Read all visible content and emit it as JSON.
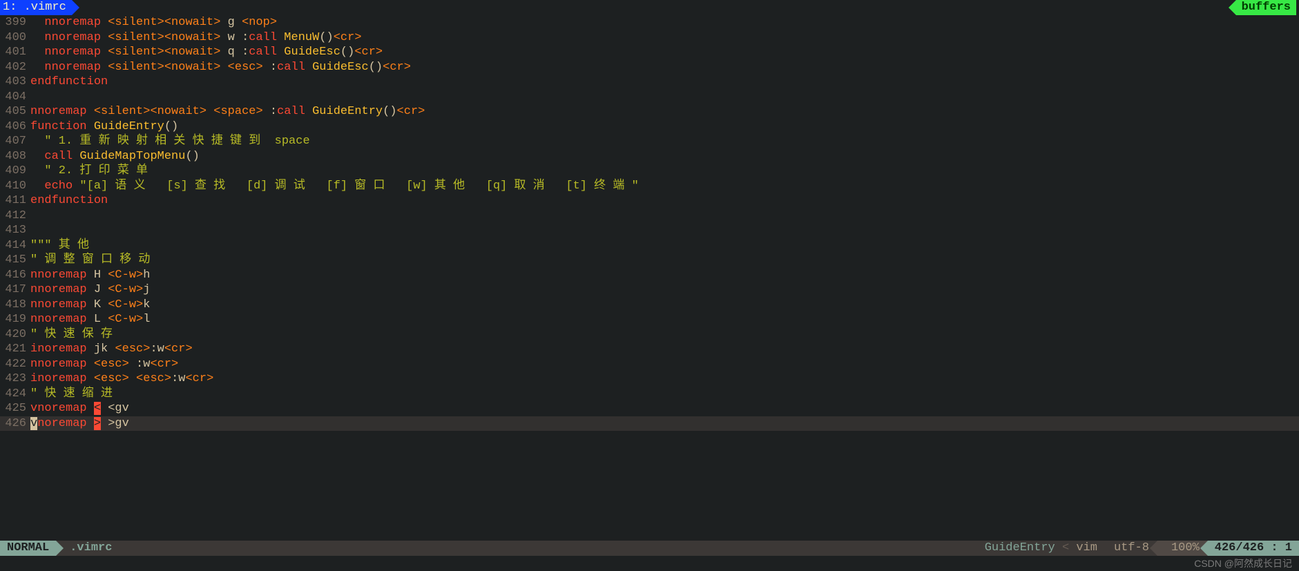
{
  "tabline": {
    "tab_label": " 1: .vimrc ",
    "buffers_label": "buffers"
  },
  "lines": [
    {
      "num": "399",
      "tokens": [
        [
          "plain",
          "  "
        ],
        [
          "kw",
          "nnoremap"
        ],
        [
          "plain",
          " "
        ],
        [
          "special",
          "<silent><nowait>"
        ],
        [
          "plain",
          " g "
        ],
        [
          "special",
          "<nop>"
        ]
      ]
    },
    {
      "num": "400",
      "tokens": [
        [
          "plain",
          "  "
        ],
        [
          "kw",
          "nnoremap"
        ],
        [
          "plain",
          " "
        ],
        [
          "special",
          "<silent><nowait>"
        ],
        [
          "plain",
          " w :"
        ],
        [
          "kw",
          "call"
        ],
        [
          "plain",
          " "
        ],
        [
          "func",
          "MenuW"
        ],
        [
          "paren",
          "()"
        ],
        [
          "special",
          "<cr>"
        ]
      ]
    },
    {
      "num": "401",
      "tokens": [
        [
          "plain",
          "  "
        ],
        [
          "kw",
          "nnoremap"
        ],
        [
          "plain",
          " "
        ],
        [
          "special",
          "<silent><nowait>"
        ],
        [
          "plain",
          " q :"
        ],
        [
          "kw",
          "call"
        ],
        [
          "plain",
          " "
        ],
        [
          "func",
          "GuideEsc"
        ],
        [
          "paren",
          "()"
        ],
        [
          "special",
          "<cr>"
        ]
      ]
    },
    {
      "num": "402",
      "tokens": [
        [
          "plain",
          "  "
        ],
        [
          "kw",
          "nnoremap"
        ],
        [
          "plain",
          " "
        ],
        [
          "special",
          "<silent><nowait>"
        ],
        [
          "plain",
          " "
        ],
        [
          "special",
          "<esc>"
        ],
        [
          "plain",
          " :"
        ],
        [
          "kw",
          "call"
        ],
        [
          "plain",
          " "
        ],
        [
          "func",
          "GuideEsc"
        ],
        [
          "paren",
          "()"
        ],
        [
          "special",
          "<cr>"
        ]
      ]
    },
    {
      "num": "403",
      "tokens": [
        [
          "kw",
          "endfunction"
        ]
      ]
    },
    {
      "num": "404",
      "tokens": []
    },
    {
      "num": "405",
      "tokens": [
        [
          "kw",
          "nnoremap"
        ],
        [
          "plain",
          " "
        ],
        [
          "special",
          "<silent><nowait>"
        ],
        [
          "plain",
          " "
        ],
        [
          "special",
          "<space>"
        ],
        [
          "plain",
          " :"
        ],
        [
          "kw",
          "call"
        ],
        [
          "plain",
          " "
        ],
        [
          "func",
          "GuideEntry"
        ],
        [
          "paren",
          "()"
        ],
        [
          "special",
          "<cr>"
        ]
      ]
    },
    {
      "num": "406",
      "tokens": [
        [
          "kw",
          "function"
        ],
        [
          "plain",
          " "
        ],
        [
          "func",
          "GuideEntry"
        ],
        [
          "paren",
          "()"
        ]
      ]
    },
    {
      "num": "407",
      "tokens": [
        [
          "plain",
          "  "
        ],
        [
          "str",
          "\" 1."
        ],
        [
          "comment-green",
          " 重 新 映 射 相 关 快 捷 键 到  "
        ],
        [
          "str",
          "space"
        ]
      ]
    },
    {
      "num": "408",
      "tokens": [
        [
          "plain",
          "  "
        ],
        [
          "kw",
          "call"
        ],
        [
          "plain",
          " "
        ],
        [
          "func",
          "GuideMapTopMenu"
        ],
        [
          "paren",
          "()"
        ]
      ]
    },
    {
      "num": "409",
      "tokens": [
        [
          "plain",
          "  "
        ],
        [
          "str",
          "\" 2."
        ],
        [
          "comment-green",
          " 打 印 菜 单"
        ]
      ]
    },
    {
      "num": "410",
      "tokens": [
        [
          "plain",
          "  "
        ],
        [
          "kw",
          "echo"
        ],
        [
          "plain",
          " "
        ],
        [
          "str",
          "\"[a]"
        ],
        [
          "comment-green",
          " 语 义   "
        ],
        [
          "str",
          "[s]"
        ],
        [
          "comment-green",
          " 查 找   "
        ],
        [
          "str",
          "[d]"
        ],
        [
          "comment-green",
          " 调 试   "
        ],
        [
          "str",
          "[f]"
        ],
        [
          "comment-green",
          " 窗 口   "
        ],
        [
          "str",
          "[w]"
        ],
        [
          "comment-green",
          " 其 他   "
        ],
        [
          "str",
          "[q]"
        ],
        [
          "comment-green",
          " 取 消   "
        ],
        [
          "str",
          "[t]"
        ],
        [
          "comment-green",
          " 终 端 "
        ],
        [
          "str",
          "\""
        ]
      ]
    },
    {
      "num": "411",
      "tokens": [
        [
          "kw",
          "endfunction"
        ]
      ]
    },
    {
      "num": "412",
      "tokens": []
    },
    {
      "num": "413",
      "tokens": []
    },
    {
      "num": "414",
      "tokens": [
        [
          "str",
          "\"\"\""
        ],
        [
          "comment-green",
          " 其 他"
        ]
      ]
    },
    {
      "num": "415",
      "tokens": [
        [
          "str",
          "\""
        ],
        [
          "comment-green",
          " 调 整 窗 口 移 动"
        ]
      ]
    },
    {
      "num": "416",
      "tokens": [
        [
          "kw",
          "nnoremap"
        ],
        [
          "plain",
          " H "
        ],
        [
          "special",
          "<C-w>"
        ],
        [
          "plain",
          "h"
        ]
      ]
    },
    {
      "num": "417",
      "tokens": [
        [
          "kw",
          "nnoremap"
        ],
        [
          "plain",
          " J "
        ],
        [
          "special",
          "<C-w>"
        ],
        [
          "plain",
          "j"
        ]
      ]
    },
    {
      "num": "418",
      "tokens": [
        [
          "kw",
          "nnoremap"
        ],
        [
          "plain",
          " K "
        ],
        [
          "special",
          "<C-w>"
        ],
        [
          "plain",
          "k"
        ]
      ]
    },
    {
      "num": "419",
      "tokens": [
        [
          "kw",
          "nnoremap"
        ],
        [
          "plain",
          " L "
        ],
        [
          "special",
          "<C-w>"
        ],
        [
          "plain",
          "l"
        ]
      ]
    },
    {
      "num": "420",
      "tokens": [
        [
          "str",
          "\""
        ],
        [
          "comment-green",
          " 快 速 保 存"
        ]
      ]
    },
    {
      "num": "421",
      "tokens": [
        [
          "kw",
          "inoremap"
        ],
        [
          "plain",
          " jk "
        ],
        [
          "special",
          "<esc>"
        ],
        [
          "plain",
          ":w"
        ],
        [
          "special",
          "<cr>"
        ]
      ]
    },
    {
      "num": "422",
      "tokens": [
        [
          "kw",
          "nnoremap"
        ],
        [
          "plain",
          " "
        ],
        [
          "special",
          "<esc>"
        ],
        [
          "plain",
          " :w"
        ],
        [
          "special",
          "<cr>"
        ]
      ]
    },
    {
      "num": "423",
      "tokens": [
        [
          "kw",
          "inoremap"
        ],
        [
          "plain",
          " "
        ],
        [
          "special",
          "<esc>"
        ],
        [
          "plain",
          " "
        ],
        [
          "special",
          "<esc>"
        ],
        [
          "plain",
          ":w"
        ],
        [
          "special",
          "<cr>"
        ]
      ]
    },
    {
      "num": "424",
      "tokens": [
        [
          "str",
          "\""
        ],
        [
          "comment-green",
          " 快 速 缩 进"
        ]
      ]
    },
    {
      "num": "425",
      "tokens": [
        [
          "kw",
          "vnoremap"
        ],
        [
          "plain",
          " "
        ],
        [
          "error-bg",
          "<"
        ],
        [
          "plain",
          " <gv"
        ]
      ]
    },
    {
      "num": "426",
      "tokens": [
        [
          "cursor",
          "v"
        ],
        [
          "kw",
          "noremap"
        ],
        [
          "plain",
          " "
        ],
        [
          "error-bg",
          ">"
        ],
        [
          "plain",
          " >gv"
        ]
      ],
      "cursor": true
    }
  ],
  "statusline": {
    "mode": " NORMAL ",
    "file": ".vimrc",
    "funcname": "GuideEntry",
    "filetype": "vim",
    "encoding": "utf-8",
    "pct": "100%",
    "pos": " 426/426 :  1 "
  },
  "watermark": "CSDN @阿然成长日记"
}
